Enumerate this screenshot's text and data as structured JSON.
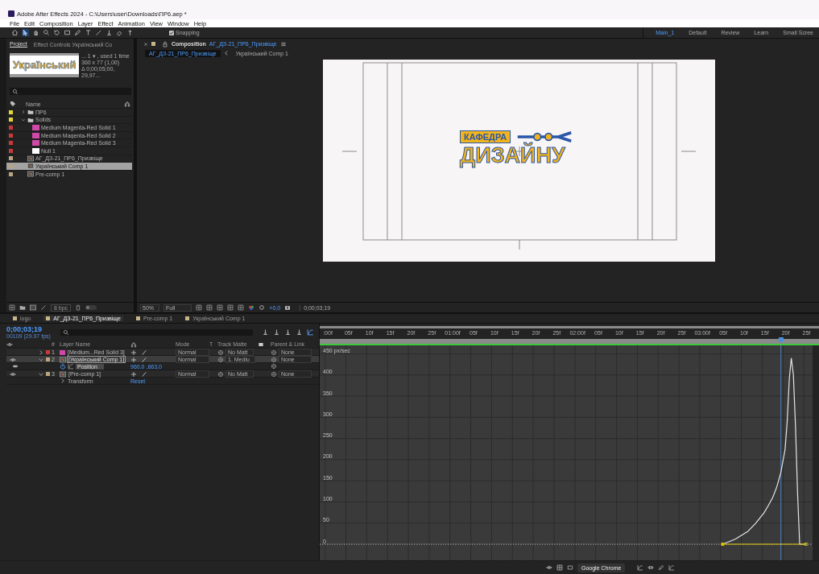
{
  "window": {
    "title": "Adobe After Effects 2024 - C:\\Users\\user\\Downloads\\ПР6.aep *"
  },
  "menu": [
    "File",
    "Edit",
    "Composition",
    "Layer",
    "Effect",
    "Animation",
    "View",
    "Window",
    "Help"
  ],
  "toolbar": {
    "snapping": {
      "label": "Snapping",
      "checked": true
    }
  },
  "workspaces": [
    {
      "label": "Main_1",
      "selected": true
    },
    {
      "label": "Default",
      "selected": false
    },
    {
      "label": "Review",
      "selected": false
    },
    {
      "label": "Learn",
      "selected": false
    },
    {
      "label": "Small Scree",
      "selected": false
    }
  ],
  "project": {
    "tabs": [
      {
        "label": "Project",
        "selected": true
      },
      {
        "label": "Effect Controls Український Co",
        "selected": false
      }
    ],
    "thumbnail": "Український",
    "info": [
      "... 1 ▾ , used 1 time",
      "360 x 77 (1,00)",
      "Δ 0;00;05;00, 29,97..."
    ],
    "name_column": "Name",
    "items": [
      {
        "name": "ПР6",
        "kind": "folder",
        "color": "#e5d33a",
        "expanded": false,
        "selected": false
      },
      {
        "name": "Solids",
        "kind": "folder",
        "color": "#e5d33a",
        "expanded": true,
        "selected": false,
        "children": [
          {
            "name": "Medium Magenta-Red Solid 1",
            "kind": "solid",
            "color": "#c83a3a",
            "selected": false
          },
          {
            "name": "Medium Magenta-Red Solid 2",
            "kind": "solid",
            "color": "#c83a3a",
            "selected": false
          },
          {
            "name": "Medium Magenta-Red Solid 3",
            "kind": "solid",
            "color": "#c83a3a",
            "selected": false
          },
          {
            "name": "Null 1",
            "kind": "null",
            "color": "#c83a3a",
            "selected": false
          }
        ]
      },
      {
        "name": "АГ_ДЗ-21_ПР6_Призвіще",
        "kind": "comp",
        "color": "#b9a582",
        "selected": false
      },
      {
        "name": "Український Comp 1",
        "kind": "comp",
        "color": "#b9a582",
        "selected": true
      },
      {
        "name": "Pre-comp 1",
        "kind": "comp",
        "color": "#b9a582",
        "selected": false
      }
    ],
    "bit_depth": "8 bpc",
    "toggle": {
      "on": false
    }
  },
  "composition": {
    "tab_title": "Composition",
    "name": "АГ_ДЗ-21_ПР6_Призвіще",
    "breadcrumbs": [
      {
        "label": "АГ_ДЗ-21_ПР6_Призвіще",
        "selected": true
      },
      {
        "label": "Український Comp 1",
        "selected": false
      }
    ],
    "logo": {
      "top": "КАФЕДРА",
      "bottom": "ДИЗАЙНУ"
    },
    "zoom": "50%",
    "resolution": "Full",
    "exposure": "+0,0",
    "timecode": "0;00;03;19"
  },
  "timeline": {
    "tabs": [
      {
        "label": "logo",
        "selected": false
      },
      {
        "label": "АГ_ДЗ-21_ПР6_Призвіще",
        "selected": true
      },
      {
        "label": "Pre-comp 1",
        "selected": false
      },
      {
        "label": "Український Comp 1",
        "selected": false
      }
    ],
    "timecode": "0;00;03;19",
    "frame": "00109 (29.97 fps)",
    "columns": {
      "number": "#",
      "layer_name": "Layer Name",
      "mode": "Mode",
      "t": "T",
      "track_matte": "Track Matte",
      "parent": "Parent & Link"
    },
    "layers": [
      {
        "number": "1",
        "name": "[Medium...Red Solid 3]",
        "kind": "solid",
        "color": "#c83a3a",
        "visible": false,
        "selected": false,
        "expanded": false,
        "mode": "Normal",
        "track_matte": "No Matt",
        "parent": "None"
      },
      {
        "number": "2",
        "name": "[Український Comp 1]",
        "kind": "comp",
        "color": "#b9a582",
        "visible": true,
        "selected": true,
        "expanded": true,
        "mode": "Normal",
        "track_matte": "1. Mediu",
        "parent": "None",
        "properties": [
          {
            "kind": "property",
            "name": "Position",
            "value": "960,0 ,663,0"
          }
        ]
      },
      {
        "number": "3",
        "name": "[Pre-comp 1]",
        "kind": "comp",
        "color": "#b9a582",
        "visible": true,
        "selected": false,
        "expanded": true,
        "mode": "Normal",
        "track_matte": "No Matt",
        "parent": "None",
        "properties": [
          {
            "kind": "group",
            "name": "Transform",
            "value": "Reset"
          }
        ]
      }
    ],
    "ruler_labels": [
      "05f",
      "10f",
      "15f",
      "20f",
      "25f",
      "05f",
      "10f",
      "15f",
      "20f",
      "25f",
      "05f",
      "10f",
      "15f",
      "20f",
      "25f"
    ],
    "graph": {
      "chart_data": {
        "type": "line",
        "x": [
          95,
          98,
          101,
          103,
          105,
          106,
          107,
          108,
          109,
          110,
          110.5,
          111,
          111.5,
          112,
          112.5,
          113,
          113.5,
          115
        ],
        "series": [
          {
            "color": "#e6e6e6",
            "values": [
              0,
              12,
              30,
              50,
              75,
              92,
              110,
              135,
              170,
              225,
              290,
              390,
              440,
              400,
              280,
              120,
              0,
              0
            ]
          },
          {
            "color": "#d8c400",
            "values": [
              0,
              0,
              0,
              0,
              0,
              0,
              0,
              0,
              0,
              0,
              0,
              0,
              0,
              0,
              0,
              0,
              0,
              0
            ]
          }
        ],
        "xlim": [
          -1.8,
          116.6
        ],
        "ylim": [
          -38,
          470
        ],
        "xticks": [
          {
            "value": 0,
            "label": ":00f"
          },
          {
            "value": 5,
            "label": "05f"
          },
          {
            "value": 10,
            "label": "10f"
          },
          {
            "value": 15,
            "label": "15f"
          },
          {
            "value": 20,
            "label": "20f"
          },
          {
            "value": 25,
            "label": "25f"
          },
          {
            "value": 30,
            "label": "01:00f"
          },
          {
            "value": 60,
            "label": "02:00f"
          },
          {
            "value": 90,
            "label": "03:00f"
          }
        ],
        "yticks": [
          0,
          50,
          100,
          150,
          200,
          250,
          300,
          350,
          400,
          {
            "value": 450,
            "label": "450 px/sec"
          }
        ],
        "grid": true,
        "ref_lines": [
          {
            "axis": "x",
            "value": 109
          },
          {
            "axis": "y",
            "value": 0
          }
        ]
      }
    }
  },
  "tooltip": "Google Chrome"
}
